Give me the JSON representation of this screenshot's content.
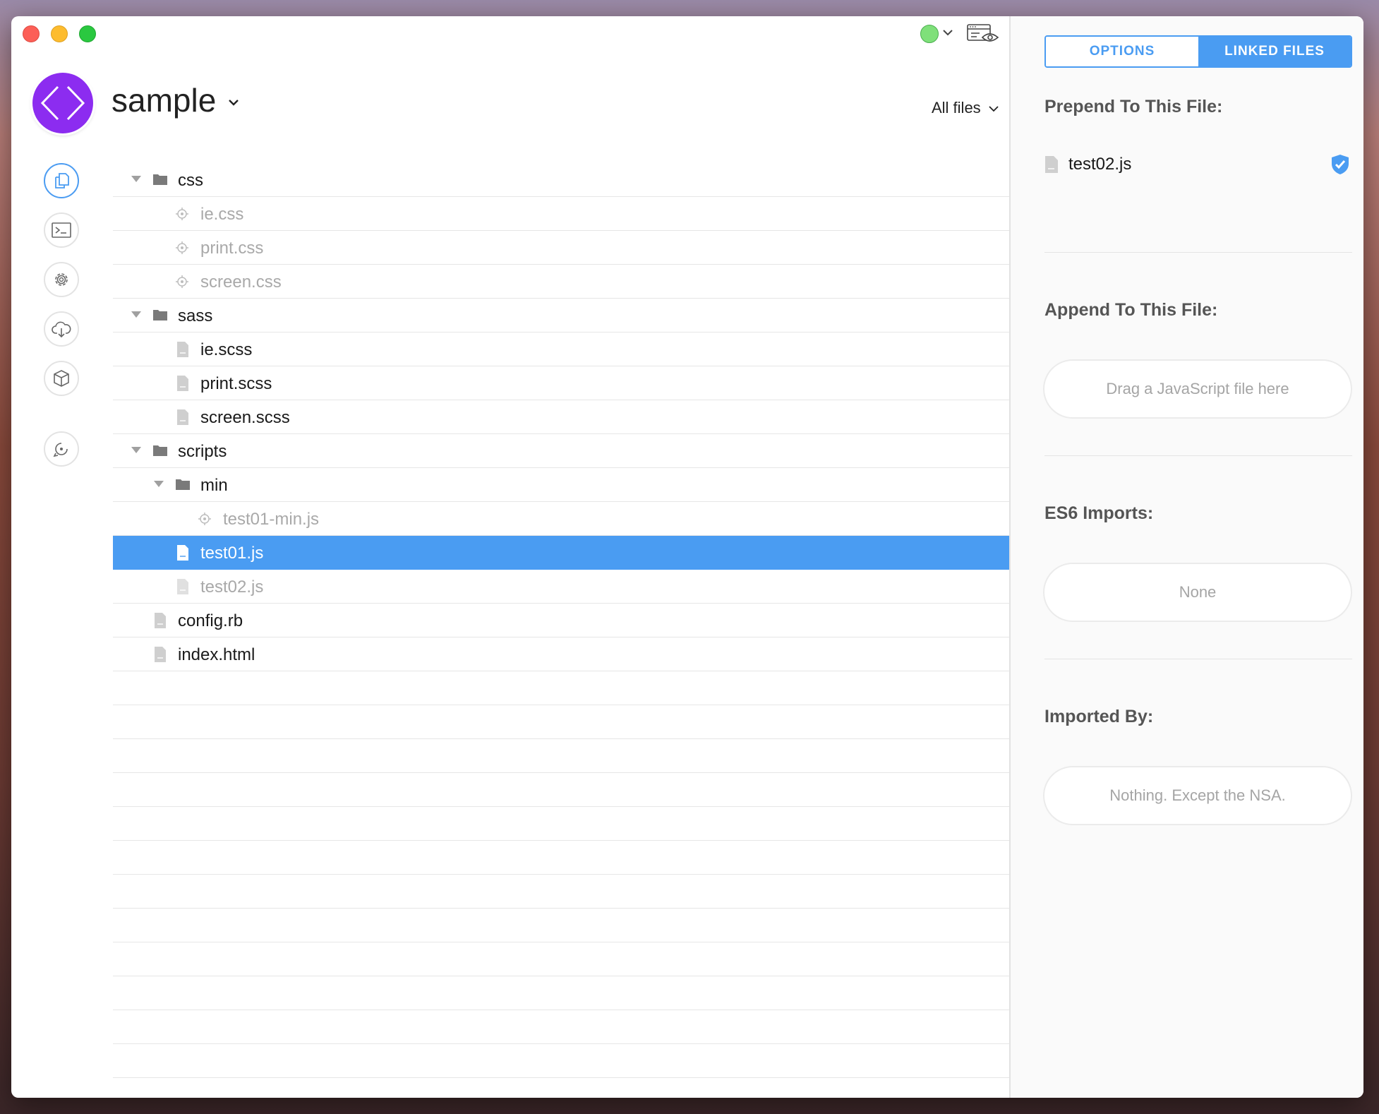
{
  "project": {
    "title": "sample",
    "filter_label": "All files"
  },
  "sidebar": {
    "items": [
      {
        "name": "files",
        "icon": "files-icon",
        "active": true
      },
      {
        "name": "log",
        "icon": "terminal-icon"
      },
      {
        "name": "settings",
        "icon": "gear-icon"
      },
      {
        "name": "sync",
        "icon": "cloud-download-icon"
      },
      {
        "name": "packages",
        "icon": "cube-icon"
      },
      {
        "name": "refresh",
        "icon": "refresh-icon"
      }
    ]
  },
  "tree": [
    {
      "label": "css",
      "type": "folder",
      "depth": 0,
      "expanded": true
    },
    {
      "label": "ie.css",
      "type": "output",
      "depth": 1,
      "dim": true
    },
    {
      "label": "print.css",
      "type": "output",
      "depth": 1,
      "dim": true
    },
    {
      "label": "screen.css",
      "type": "output",
      "depth": 1,
      "dim": true
    },
    {
      "label": "sass",
      "type": "folder",
      "depth": 0,
      "expanded": true
    },
    {
      "label": "ie.scss",
      "type": "file",
      "depth": 1
    },
    {
      "label": "print.scss",
      "type": "file",
      "depth": 1
    },
    {
      "label": "screen.scss",
      "type": "file",
      "depth": 1
    },
    {
      "label": "scripts",
      "type": "folder",
      "depth": 0,
      "expanded": true
    },
    {
      "label": "min",
      "type": "folder",
      "depth": 1,
      "expanded": true
    },
    {
      "label": "test01-min.js",
      "type": "output",
      "depth": 2,
      "dim": true
    },
    {
      "label": "test01.js",
      "type": "file",
      "depth": 1,
      "selected": true
    },
    {
      "label": "test02.js",
      "type": "file",
      "depth": 1,
      "dim": true
    },
    {
      "label": "config.rb",
      "type": "file",
      "depth": 0
    },
    {
      "label": "index.html",
      "type": "file",
      "depth": 0
    }
  ],
  "panel": {
    "tabs": [
      {
        "label": "OPTIONS",
        "active": false
      },
      {
        "label": "LINKED FILES",
        "active": true
      }
    ],
    "prepend": {
      "title": "Prepend To This File:",
      "file": "test02.js"
    },
    "append": {
      "title": "Append To This File:",
      "placeholder": "Drag a JavaScript file here"
    },
    "es6": {
      "title": "ES6 Imports:",
      "value": "None"
    },
    "imported_by": {
      "title": "Imported By:",
      "value": "Nothing. Except the NSA."
    }
  },
  "colors": {
    "accent": "#4a9cf2",
    "logo": "#8c2cf0",
    "status": "#7fe07a"
  }
}
